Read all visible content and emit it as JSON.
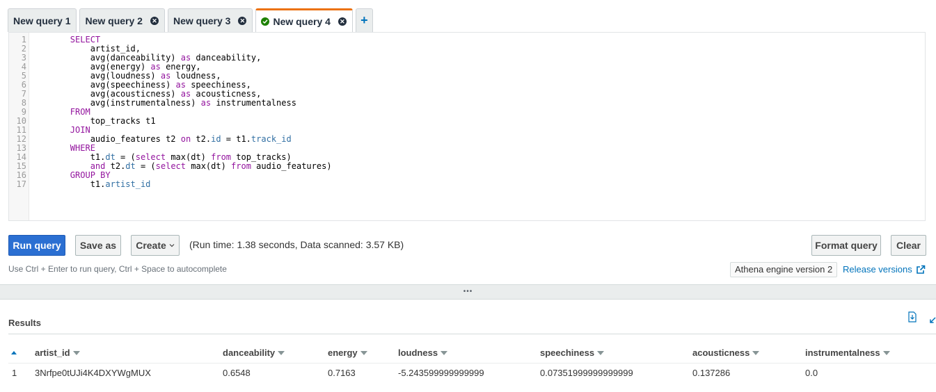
{
  "tabs": [
    {
      "label": "New query 1",
      "closable": false,
      "active": false
    },
    {
      "label": "New query 2",
      "closable": true,
      "active": false
    },
    {
      "label": "New query 3",
      "closable": true,
      "active": false
    },
    {
      "label": "New query 4",
      "closable": true,
      "active": true,
      "status": "success"
    }
  ],
  "tab_add_label": "+",
  "editor": {
    "line_numbers": [
      "1",
      "2",
      "3",
      "4",
      "5",
      "6",
      "7",
      "8",
      "9",
      "10",
      "11",
      "12",
      "13",
      "14",
      "15",
      "16",
      "17"
    ]
  },
  "toolbar": {
    "run_label": "Run query",
    "save_as_label": "Save as",
    "create_label": "Create",
    "runtime_text": "(Run time: 1.38 seconds, Data scanned: 3.57 KB)",
    "format_label": "Format query",
    "clear_label": "Clear",
    "hint": "Use Ctrl + Enter to run query, Ctrl + Space to autocomplete",
    "engine_version": "Athena engine version 2",
    "release_versions_label": "Release versions"
  },
  "splitter_glyph": "•••",
  "results": {
    "title": "Results",
    "columns": [
      "artist_id",
      "danceability",
      "energy",
      "loudness",
      "speechiness",
      "acousticness",
      "instrumentalness"
    ],
    "rows": [
      {
        "row_num": "1",
        "cells": [
          "3Nrfpe0tUJi4K4DXYWgMUX",
          "0.6548",
          "0.7163",
          "-5.243599999999999",
          "0.07351999999999999",
          "0.137286",
          "0.0"
        ]
      }
    ]
  },
  "colors": {
    "accent": "#ec7211",
    "primary_button": "#2b6fd2",
    "link": "#0073bb",
    "success": "#1d8102",
    "keyword": "#93149e",
    "field": "#316fa3"
  }
}
